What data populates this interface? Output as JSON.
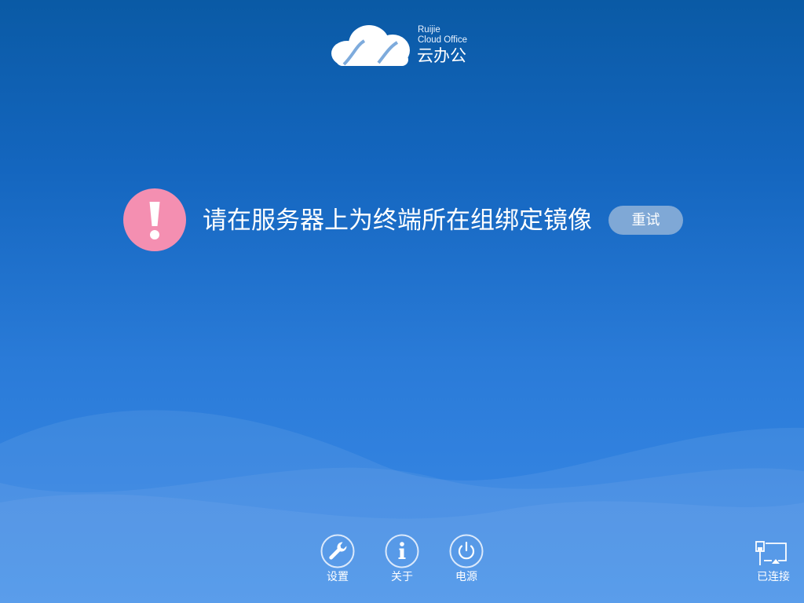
{
  "logo": {
    "brand_line1": "Ruijie",
    "brand_line2": "Cloud Office",
    "product_name": "云办公",
    "icon": "cloud-logo-icon"
  },
  "alert": {
    "icon": "exclamation-circle-icon",
    "icon_color": "#f48fb1",
    "message": "请在服务器上为终端所在组绑定镜像",
    "retry_label": "重试"
  },
  "toolbar": {
    "items": [
      {
        "label": "设置",
        "icon": "wrench-icon"
      },
      {
        "label": "关于",
        "icon": "info-icon"
      },
      {
        "label": "电源",
        "icon": "power-icon"
      }
    ]
  },
  "network": {
    "status_label": "已连接",
    "icon": "network-connected-icon"
  },
  "colors": {
    "background_top": "#0a5aa5",
    "background_bottom": "#3b8ae8",
    "retry_button": "#7fa8d6"
  }
}
